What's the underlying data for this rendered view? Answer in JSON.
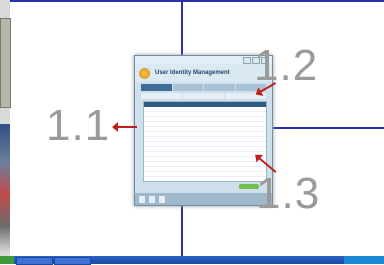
{
  "callouts": {
    "c1_1": "1.1",
    "c1_2": "1.2",
    "c1_3": "1.3"
  },
  "dialog": {
    "window_title": "",
    "heading": "User Identity Management",
    "tabs": [
      "",
      "",
      "",
      ""
    ],
    "subtabs": [
      "",
      "",
      ""
    ]
  },
  "colors": {
    "guide": "#2a2fb0",
    "arrow": "#c21d1d",
    "callout_text": "#9a9a9a"
  },
  "icons": [
    "logo-icon",
    "window-minimize-icon",
    "window-maximize-icon",
    "window-close-icon",
    "start-button-icon"
  ]
}
